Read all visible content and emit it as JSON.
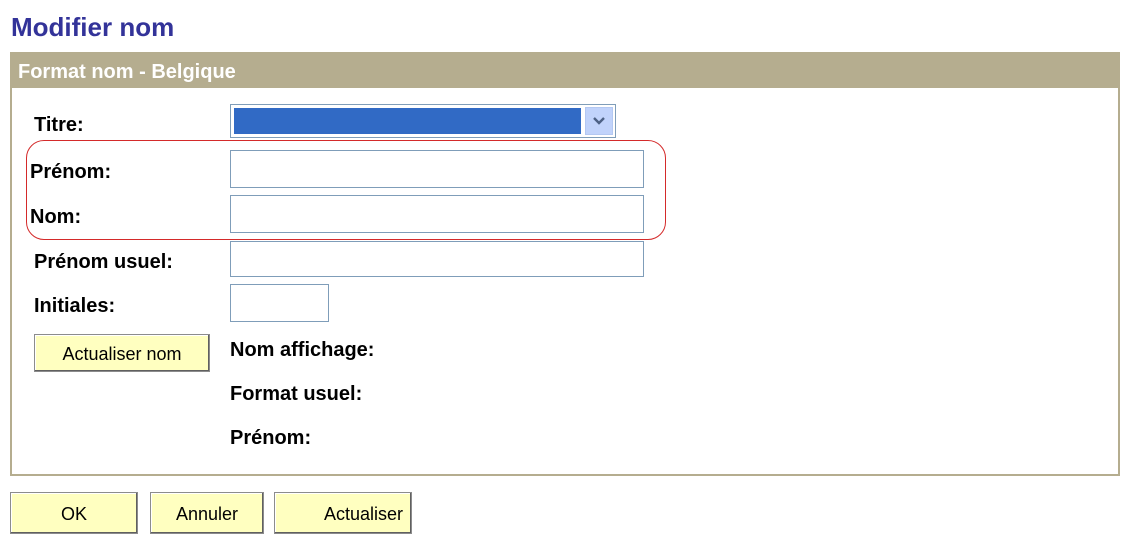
{
  "page": {
    "title": "Modifier nom"
  },
  "panel": {
    "header": "Format nom - Belgique"
  },
  "form": {
    "title_label": "Titre:",
    "title_value": "",
    "first_name_label": "Prénom:",
    "first_name_value": "",
    "last_name_label": "Nom:",
    "last_name_value": "",
    "preferred_name_label": "Prénom usuel:",
    "preferred_name_value": "",
    "initials_label": "Initiales:",
    "initials_value": "",
    "update_name_button": "Actualiser nom",
    "display_name_label": "Nom affichage:",
    "usual_format_label": "Format usuel:",
    "first_name_display_label": "Prénom:"
  },
  "footer": {
    "ok_label": "OK",
    "cancel_label": "Annuler",
    "refresh_label": "Actualiser"
  },
  "colors": {
    "title": "#333399",
    "panel_header_bg": "#b5ad8f",
    "button_bg": "#ffffc0",
    "select_highlight": "#316ac5",
    "annotation_outline": "#d42a2a"
  },
  "icons": {
    "select_arrow": "chevron-down-icon"
  }
}
